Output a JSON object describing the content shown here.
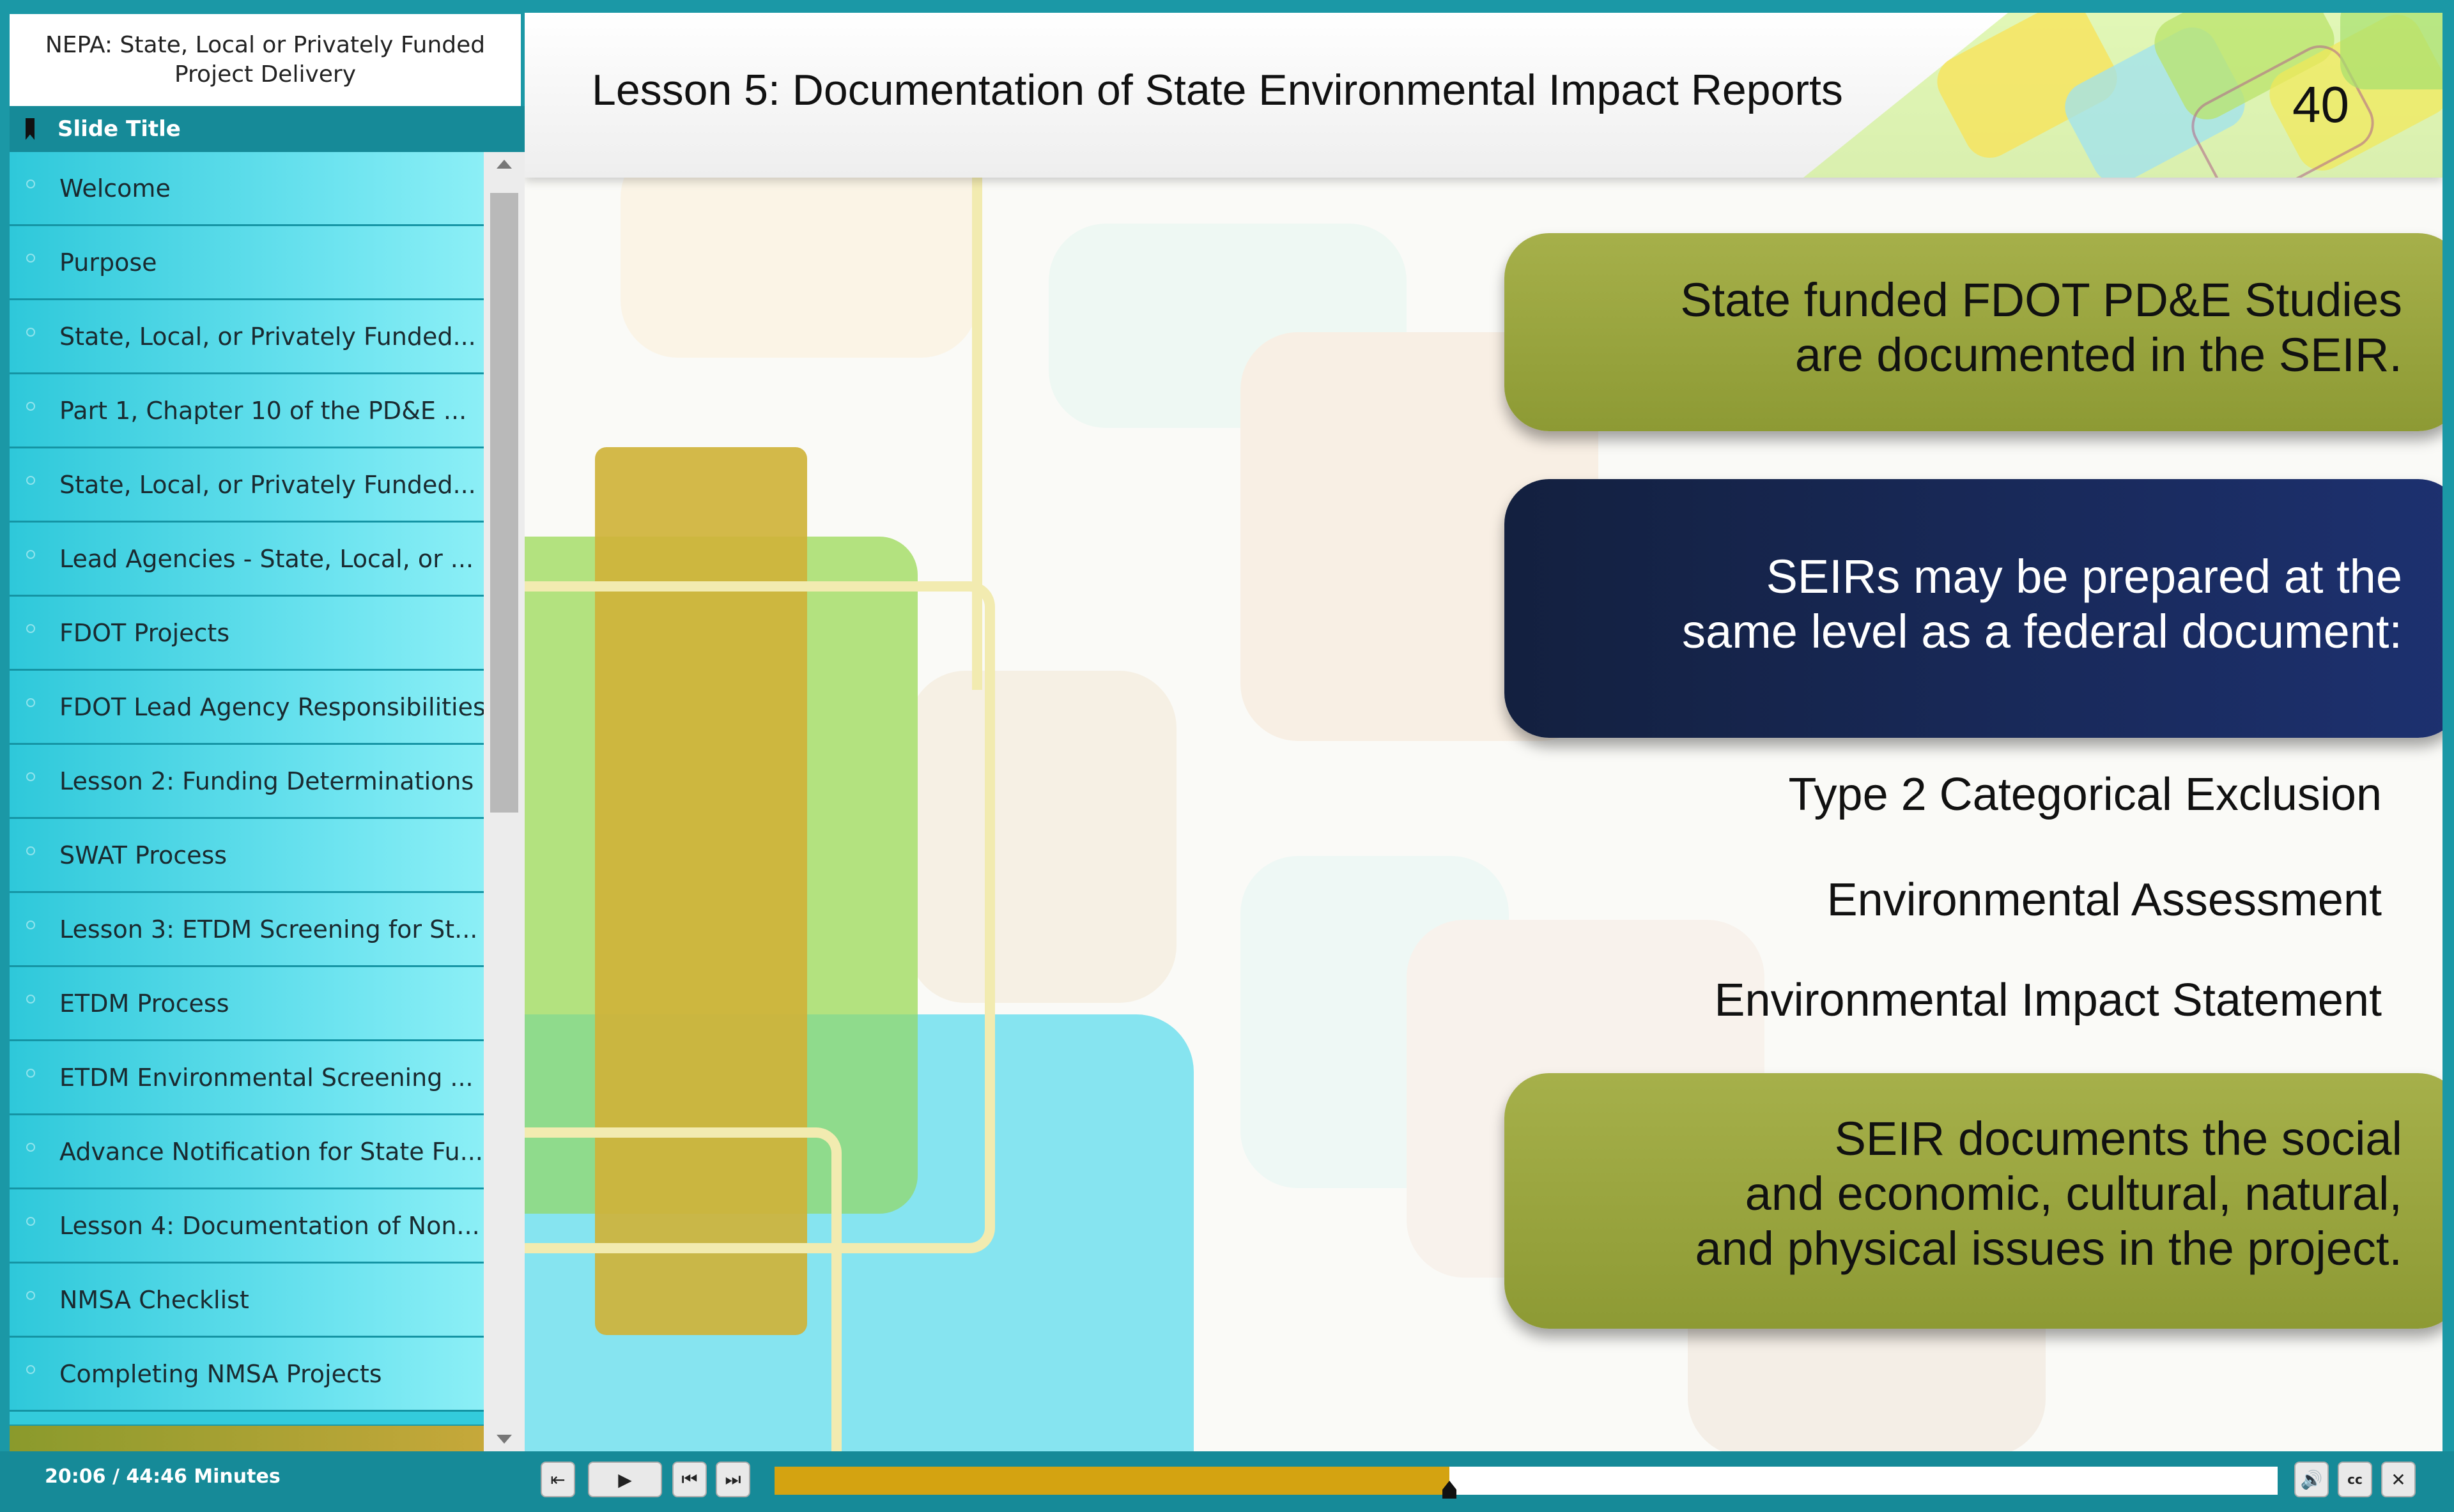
{
  "course": {
    "title": "NEPA: State, Local or Privately Funded Project Delivery"
  },
  "sidebar": {
    "header_label": "Slide Title",
    "items": [
      {
        "label": "Welcome"
      },
      {
        "label": "Purpose"
      },
      {
        "label": "State, Local, or Privately Funded..."
      },
      {
        "label": "Part 1, Chapter 10 of the PD&E ..."
      },
      {
        "label": "State, Local, or Privately Funded..."
      },
      {
        "label": "Lead Agencies - State, Local, or ..."
      },
      {
        "label": "FDOT Projects"
      },
      {
        "label": "FDOT Lead Agency Responsibilities"
      },
      {
        "label": "Lesson 2: Funding Determinations"
      },
      {
        "label": "SWAT Process"
      },
      {
        "label": "Lesson 3: ETDM Screening for St..."
      },
      {
        "label": "ETDM Process"
      },
      {
        "label": "ETDM Environmental Screening ..."
      },
      {
        "label": "Advance Notification for State Fu..."
      },
      {
        "label": "Lesson 4: Documentation of Non..."
      },
      {
        "label": "NMSA Checklist"
      },
      {
        "label": "Completing NMSA Projects"
      }
    ]
  },
  "slide": {
    "title": "Lesson 5: Documentation of State Environmental Impact Reports",
    "page_number": "40",
    "panel_1": "State funded FDOT PD&E Studies\nare documented in the SEIR.",
    "panel_2": "SEIRs may be prepared at the\nsame level as a federal document:",
    "levels": [
      "Type 2 Categorical Exclusion",
      "Environmental Assessment",
      "Environmental Impact Statement"
    ],
    "panel_3": "SEIR documents the social\nand economic, cultural, natural,\nand physical issues in the project."
  },
  "player": {
    "time": "20:06 / 44:46 Minutes",
    "progress_fraction": 0.449,
    "colors": {
      "accent": "#168a98",
      "progress": "#d4a311",
      "olive_panel": "#8f9a36",
      "navy_panel": "#1b2c62"
    },
    "icons": [
      "exit-icon",
      "play-icon",
      "previous-icon",
      "next-icon",
      "volume-icon",
      "captions-icon",
      "close-icon"
    ]
  }
}
